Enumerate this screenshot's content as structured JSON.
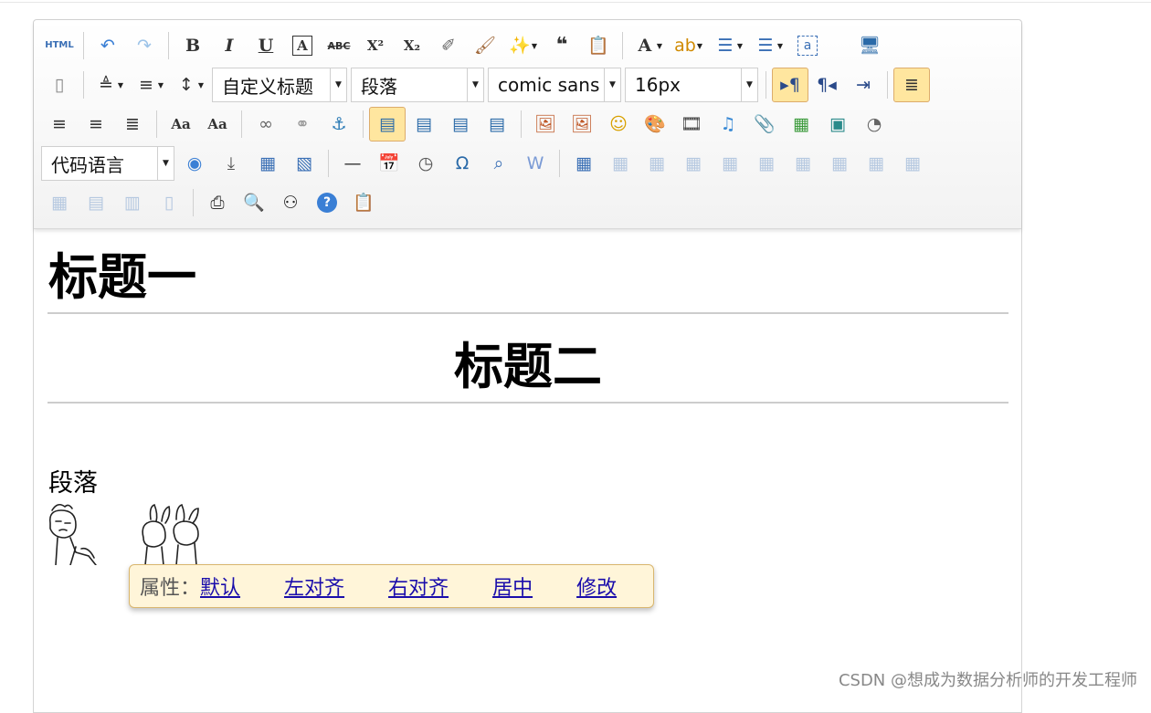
{
  "toolbar": {
    "row1": [
      {
        "name": "source-html-button",
        "icon": "html-icon",
        "label": "HTML"
      },
      {
        "sep": true
      },
      {
        "name": "undo-button",
        "icon": "undo-icon",
        "glyph": "↶"
      },
      {
        "name": "redo-button",
        "icon": "redo-icon",
        "glyph": "↷"
      },
      {
        "sep": true
      },
      {
        "name": "bold-button",
        "icon": "bold-icon",
        "glyph": "B"
      },
      {
        "name": "italic-button",
        "icon": "italic-icon",
        "glyph": "I"
      },
      {
        "name": "underline-button",
        "icon": "underline-icon",
        "glyph": "U"
      },
      {
        "name": "font-border-button",
        "icon": "font-border-icon",
        "glyph": "A"
      },
      {
        "name": "strikethrough-button",
        "icon": "strikethrough-icon",
        "glyph": "ABC"
      },
      {
        "name": "superscript-button",
        "icon": "superscript-icon",
        "glyph": "X²"
      },
      {
        "name": "subscript-button",
        "icon": "subscript-icon",
        "glyph": "X₂"
      },
      {
        "name": "remove-format-button",
        "icon": "eraser-icon",
        "glyph": "✐"
      },
      {
        "name": "format-match-button",
        "icon": "brush-icon",
        "glyph": "🖌"
      },
      {
        "name": "auto-typeset-button",
        "icon": "magic-wand-icon",
        "glyph": "✨",
        "dropdown": true
      },
      {
        "name": "blockquote-button",
        "icon": "quote-icon",
        "glyph": "❝"
      },
      {
        "name": "paste-plain-button",
        "icon": "paste-text-icon",
        "glyph": "📋"
      },
      {
        "sep": true
      },
      {
        "name": "font-color-button",
        "icon": "font-color-icon",
        "glyph": "A",
        "dropdown": true
      },
      {
        "name": "back-color-button",
        "icon": "highlight-icon",
        "glyph": "ab",
        "dropdown": true
      },
      {
        "name": "ordered-list-button",
        "icon": "ordered-list-icon",
        "glyph": "☰",
        "dropdown": true
      },
      {
        "name": "unordered-list-button",
        "icon": "unordered-list-icon",
        "glyph": "☰",
        "dropdown": true
      },
      {
        "name": "select-all-button",
        "icon": "select-all-icon",
        "glyph": "a"
      },
      {
        "spacer": true
      },
      {
        "name": "preview-button",
        "icon": "monitor-icon",
        "glyph": "🖥"
      }
    ],
    "row2_left": [
      {
        "name": "new-document-button",
        "icon": "blank-page-icon",
        "glyph": "▯"
      },
      {
        "sep": true
      },
      {
        "name": "row-spacing-top-button",
        "icon": "row-spacing-top-icon",
        "glyph": "≜",
        "dropdown": true
      },
      {
        "name": "row-spacing-bottom-button",
        "icon": "row-spacing-bottom-icon",
        "glyph": "≡",
        "dropdown": true
      },
      {
        "name": "line-height-button",
        "icon": "line-height-icon",
        "glyph": "↕",
        "dropdown": true
      }
    ],
    "combos": {
      "custom_style": "自定义标题",
      "paragraph": "段落",
      "font_family": "comic sans",
      "font_size": "16px"
    },
    "row2_right": [
      {
        "name": "ltr-direction-button",
        "icon": "ltr-icon",
        "glyph": "▸¶",
        "active": true
      },
      {
        "name": "rtl-direction-button",
        "icon": "rtl-icon",
        "glyph": "¶◂"
      },
      {
        "name": "indent-button",
        "icon": "indent-icon",
        "glyph": "⇥"
      },
      {
        "sep": true
      },
      {
        "name": "justify-left-button",
        "icon": "align-left-icon",
        "glyph": "≣",
        "active": true
      }
    ],
    "row3": [
      {
        "name": "justify-center-button",
        "icon": "align-center-icon",
        "glyph": "≡"
      },
      {
        "name": "justify-right-button",
        "icon": "align-right-icon",
        "glyph": "≡"
      },
      {
        "name": "justify-full-button",
        "icon": "align-justify-icon",
        "glyph": "≣"
      },
      {
        "sep": true
      },
      {
        "name": "to-uppercase-button",
        "icon": "uppercase-icon",
        "glyph": "Aa"
      },
      {
        "name": "to-lowercase-button",
        "icon": "lowercase-icon",
        "glyph": "Aa"
      },
      {
        "sep": true
      },
      {
        "name": "link-button",
        "icon": "link-icon",
        "glyph": "∞"
      },
      {
        "name": "unlink-button",
        "icon": "unlink-icon",
        "glyph": "⚭"
      },
      {
        "name": "anchor-button",
        "icon": "anchor-icon",
        "glyph": "⚓"
      },
      {
        "sep": true
      },
      {
        "name": "image-none-button",
        "icon": "image-inline-icon",
        "glyph": "▤",
        "active": true
      },
      {
        "name": "image-left-button",
        "icon": "image-left-icon",
        "glyph": "▤"
      },
      {
        "name": "image-right-button",
        "icon": "image-right-icon",
        "glyph": "▤"
      },
      {
        "name": "image-center-button",
        "icon": "image-center-icon",
        "glyph": "▤"
      },
      {
        "sep": true
      },
      {
        "name": "simple-upload-button",
        "icon": "image-icon",
        "glyph": "🖼"
      },
      {
        "name": "insert-image-button",
        "icon": "images-icon",
        "glyph": "🖼"
      },
      {
        "name": "emotion-button",
        "icon": "smiley-icon",
        "glyph": "☺"
      },
      {
        "name": "scrawl-button",
        "icon": "palette-icon",
        "glyph": "🎨"
      },
      {
        "name": "insert-video-button",
        "icon": "film-icon",
        "glyph": "🎞"
      },
      {
        "name": "music-button",
        "icon": "music-icon",
        "glyph": "♫"
      },
      {
        "name": "attachment-button",
        "icon": "paperclip-icon",
        "glyph": "📎"
      },
      {
        "name": "gmap-button",
        "icon": "map-icon",
        "glyph": "▦"
      },
      {
        "name": "insert-frame-button",
        "icon": "frame-icon",
        "glyph": "▣"
      },
      {
        "name": "insert-code-button",
        "icon": "webapp-icon",
        "glyph": "◔"
      }
    ],
    "code_language": "代码语言",
    "row4": [
      {
        "name": "web-app-button",
        "icon": "globe-icon",
        "glyph": "◉"
      },
      {
        "name": "page-break-button",
        "icon": "page-break-icon",
        "glyph": "⤓"
      },
      {
        "name": "template-button",
        "icon": "template-icon",
        "glyph": "▦"
      },
      {
        "name": "background-button",
        "icon": "background-icon",
        "glyph": "▧"
      },
      {
        "sep": true
      },
      {
        "name": "horizontal-rule-button",
        "icon": "horizontal-line-icon",
        "glyph": "—"
      },
      {
        "name": "date-button",
        "icon": "calendar-icon",
        "glyph": "📅"
      },
      {
        "name": "time-button",
        "icon": "clock-icon",
        "glyph": "◷"
      },
      {
        "name": "special-chars-button",
        "icon": "omega-icon",
        "glyph": "Ω"
      },
      {
        "name": "search-replace-button",
        "icon": "find-replace-icon",
        "glyph": "⌕"
      },
      {
        "name": "word-image-button",
        "icon": "word-image-icon",
        "glyph": "W"
      },
      {
        "sep": true
      },
      {
        "name": "insert-table-button",
        "icon": "table-icon",
        "glyph": "▦"
      },
      {
        "name": "delete-table-button",
        "icon": "table-delete-icon",
        "glyph": "▦",
        "disabled": true
      },
      {
        "name": "insert-paragraph-before-table-button",
        "icon": "table-paragraph-icon",
        "glyph": "▦",
        "disabled": true
      },
      {
        "name": "insert-row-button",
        "icon": "insert-row-icon",
        "glyph": "▦",
        "disabled": true
      },
      {
        "name": "delete-row-button",
        "icon": "delete-row-icon",
        "glyph": "▦",
        "disabled": true
      },
      {
        "name": "insert-col-button",
        "icon": "insert-col-icon",
        "glyph": "▦",
        "disabled": true
      },
      {
        "name": "delete-col-button",
        "icon": "delete-col-icon",
        "glyph": "▦",
        "disabled": true
      },
      {
        "name": "merge-cells-button",
        "icon": "merge-cells-icon",
        "glyph": "▦",
        "disabled": true
      },
      {
        "name": "merge-right-button",
        "icon": "merge-right-icon",
        "glyph": "▦",
        "disabled": true
      },
      {
        "name": "merge-down-button",
        "icon": "merge-down-icon",
        "glyph": "▦",
        "disabled": true
      }
    ],
    "row5": [
      {
        "name": "split-to-cells-button",
        "icon": "split-cells-icon",
        "glyph": "▦",
        "disabled": true
      },
      {
        "name": "split-to-rows-button",
        "icon": "split-rows-icon",
        "glyph": "▤",
        "disabled": true
      },
      {
        "name": "split-to-cols-button",
        "icon": "split-cols-icon",
        "glyph": "▥",
        "disabled": true
      },
      {
        "name": "chart-button",
        "icon": "chart-icon",
        "glyph": "▯",
        "disabled": true
      },
      {
        "sep": true
      },
      {
        "name": "print-button",
        "icon": "printer-icon",
        "glyph": "⎙"
      },
      {
        "name": "preview-zoom-button",
        "icon": "magnifier-icon",
        "glyph": "🔍"
      },
      {
        "name": "search-button",
        "icon": "binoculars-icon",
        "glyph": "⚇"
      },
      {
        "name": "help-button",
        "icon": "help-icon",
        "glyph": "?"
      },
      {
        "name": "drafts-button",
        "icon": "clipboard-icon",
        "glyph": "📋"
      }
    ]
  },
  "content": {
    "heading1": "标题一",
    "heading2": "标题二",
    "paragraph": "段落"
  },
  "popup": {
    "label": "属性：",
    "links": [
      "默认",
      "左对齐",
      "右对齐",
      "居中",
      "修改"
    ]
  },
  "watermark": "CSDN @想成为数据分析师的开发工程师",
  "colors": {
    "active_bg": "#ffe69f",
    "link": "#1a0dab",
    "popup_bg": "#fff5d9"
  }
}
